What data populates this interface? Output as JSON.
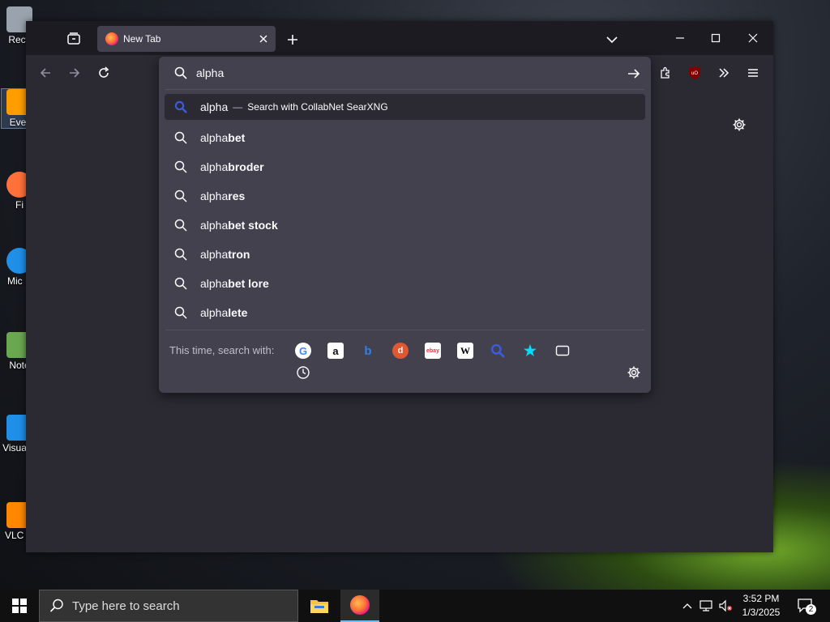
{
  "desktop": {
    "icons": [
      {
        "label": "Recy",
        "color": "#9aa3ad"
      },
      {
        "label": "Ever",
        "color": "#ff9d00"
      },
      {
        "label": "Fi",
        "color": "#ff7139"
      },
      {
        "label": "Mic E",
        "color": "#1f8fe8"
      },
      {
        "label": "Note",
        "color": "#6aa84f"
      },
      {
        "label": "Visua C",
        "color": "#1f8fe8"
      },
      {
        "label": "VLC pl",
        "color": "#ff8800"
      }
    ]
  },
  "browser": {
    "tab": {
      "title": "New Tab"
    },
    "urlbar": {
      "value": "alpha"
    },
    "results": [
      {
        "typed": "alpha",
        "rest": "",
        "action": "Search with CollabNet SearXNG",
        "selected": true
      },
      {
        "typed": "alpha",
        "rest": "bet"
      },
      {
        "typed": "alpha",
        "rest": "broder"
      },
      {
        "typed": "alpha",
        "rest": "res"
      },
      {
        "typed": "alpha",
        "rest": "bet stock"
      },
      {
        "typed": "alpha",
        "rest": "tron"
      },
      {
        "typed": "alpha",
        "rest": "bet lore"
      },
      {
        "typed": "alpha",
        "rest": "lete"
      }
    ],
    "dash": "—",
    "one_off": {
      "label": "This time, search with:",
      "engines": [
        {
          "name": "google-icon",
          "glyph": "G",
          "bg": "#ffffff",
          "fg": "#4285f4"
        },
        {
          "name": "amazon-icon",
          "glyph": "a",
          "bg": "#ffffff",
          "fg": "#111111"
        },
        {
          "name": "bing-icon",
          "glyph": "b",
          "bg": "transparent",
          "fg": "#2f7fe8"
        },
        {
          "name": "duckduckgo-icon",
          "glyph": "d",
          "bg": "#de5833",
          "fg": "#ffffff"
        },
        {
          "name": "ebay-icon",
          "glyph": "ebay",
          "bg": "#ffffff",
          "fg": "#e53238"
        },
        {
          "name": "wikipedia-icon",
          "glyph": "W",
          "bg": "#ffffff",
          "fg": "#000000"
        },
        {
          "name": "searxng-icon",
          "glyph": "",
          "bg": "transparent",
          "fg": "#3b5bdb"
        },
        {
          "name": "bookmarks-icon",
          "glyph": "★",
          "bg": "transparent",
          "fg": "#00ddff"
        },
        {
          "name": "tabs-icon",
          "glyph": "",
          "bg": "transparent",
          "fg": "#fbfbfe"
        },
        {
          "name": "history-icon",
          "glyph": "",
          "bg": "transparent",
          "fg": "#fbfbfe"
        }
      ]
    }
  },
  "taskbar": {
    "search_placeholder": "Type here to search",
    "time": "3:52 PM",
    "date": "1/3/2025",
    "notification_count": "2"
  },
  "colors": {
    "toolbar": "#2b2a33",
    "panel": "#42414d",
    "accent": "#00ddff"
  }
}
